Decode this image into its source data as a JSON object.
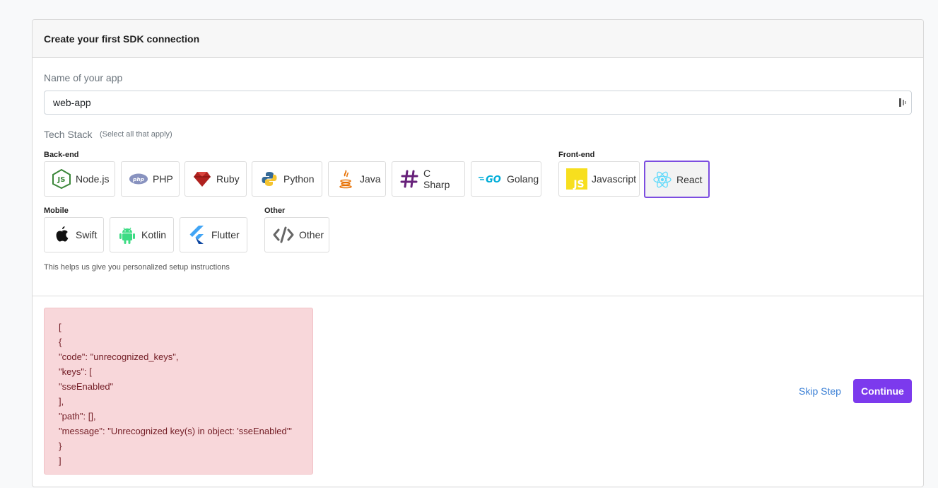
{
  "header": {
    "title": "Create your first SDK connection"
  },
  "app_name": {
    "label": "Name of your app",
    "value": "web-app"
  },
  "tech_stack": {
    "label": "Tech Stack",
    "hint": "(Select all that apply)"
  },
  "groups": {
    "backend": "Back-end",
    "frontend": "Front-end",
    "mobile": "Mobile",
    "other": "Other"
  },
  "tiles": {
    "nodejs": "Node.js",
    "php": "PHP",
    "ruby": "Ruby",
    "python": "Python",
    "java": "Java",
    "csharp": "C Sharp",
    "golang": "Golang",
    "javascript": "Javascript",
    "react": "React",
    "swift": "Swift",
    "kotlin": "Kotlin",
    "flutter": "Flutter",
    "other": "Other"
  },
  "selected_tile": "react",
  "footer_hint": "This helps us give you personalized setup instructions",
  "error_text": "[\n{\n\"code\": \"unrecognized_keys\",\n\"keys\": [\n\"sseEnabled\"\n],\n\"path\": [],\n\"message\": \"Unrecognized key(s) in object: 'sseEnabled'\"\n}\n]",
  "actions": {
    "skip": "Skip Step",
    "continue": "Continue"
  },
  "colors": {
    "accent": "#7c3aed",
    "error_bg": "#f8d7da",
    "error_text": "#721c24",
    "link": "#3a7fd5"
  }
}
